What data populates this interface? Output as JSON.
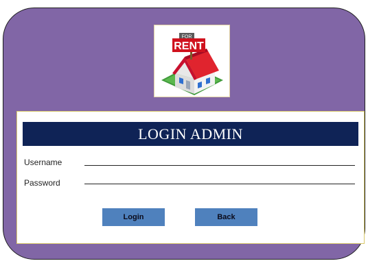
{
  "logo": {
    "sign_top": "FOR",
    "sign_main": "RENT"
  },
  "login": {
    "title": "LOGIN ADMIN",
    "username_label": "Username",
    "username_value": "",
    "password_label": "Password",
    "password_value": "",
    "login_button": "Login",
    "back_button": "Back"
  },
  "colors": {
    "background": "#8166a6",
    "title_bar": "#0f2356",
    "button": "#4f81bd"
  }
}
